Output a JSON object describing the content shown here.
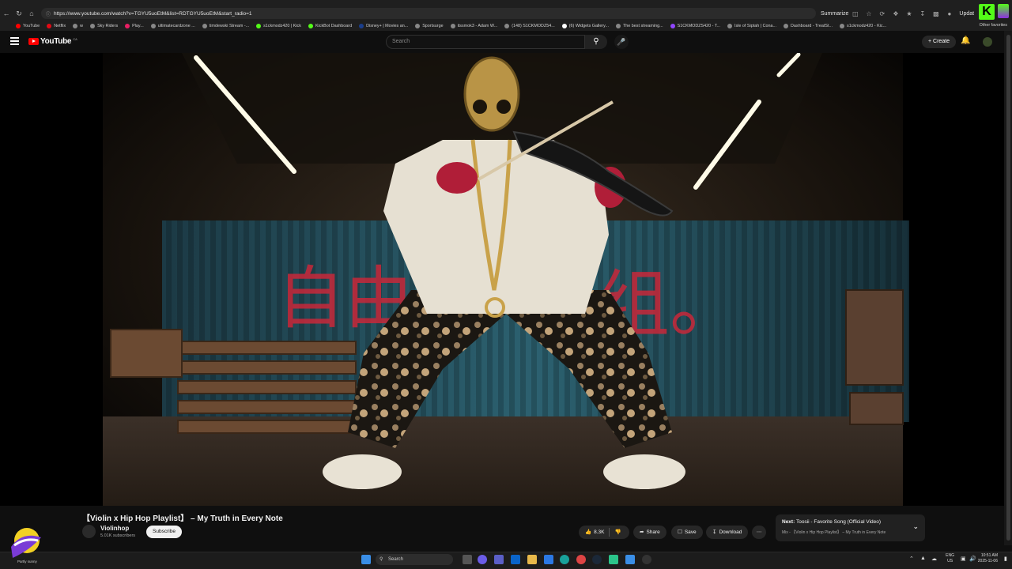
{
  "browser": {
    "url": "https://www.youtube.com/watch?v=TGYU5uoEtM&list=RDTGYU5uoEtM&start_radio=1",
    "summarize_label": "Summarize",
    "update_label": "Updat",
    "bookmarks": [
      "YouTube",
      "Netflix",
      "w",
      "Sky Riders",
      "Play...",
      "ultimatecardzone ...",
      "timdewski Stream -...",
      "s1ckmodz420 | Kick",
      "KickBot Dashboard",
      "Disney+ | Movies an...",
      "Sportsurge",
      "itssmok3 - Adam W...",
      "(148) S1CKMODZ54...",
      "(6) Widgets Gallery...",
      "The best streaming...",
      "S1CKMODZS420 - T...",
      "Isle of Siptah | Cona...",
      "Dashboard - TreatSt...",
      "s1ckmodz420 - Kic..."
    ],
    "other_favorites": "Other favorites"
  },
  "youtube": {
    "logo_text": "YouTube",
    "region": "CA",
    "search_placeholder": "Search",
    "create_label": "Create"
  },
  "video": {
    "title": "【Violin x Hip Hop Playlist】 – My Truth in Every Note",
    "channel": "Violinhop",
    "subscribers": "5.01K subscribers",
    "subscribe_label": "Subscribe",
    "likes": "8.3K",
    "share_label": "Share",
    "save_label": "Save",
    "download_label": "Download",
    "graffiti_left": "自由",
    "graffiti_right": "组。"
  },
  "next": {
    "prefix": "Next:",
    "title": "Toosii - Favorite Song (Official Video)",
    "subtitle": "Mix - 【Violin x Hip Hop Playlist】 – My Truth in Every Note"
  },
  "taskbar": {
    "weather": "Partly sunny",
    "search_label": "Search",
    "lang_top": "ENG",
    "lang_bottom": "US",
    "time": "10:51 AM",
    "date": "2025-11-06"
  },
  "colors": {
    "yt_red": "#ff0000",
    "kick_green": "#53fc18",
    "bg": "#0f0f0f"
  }
}
